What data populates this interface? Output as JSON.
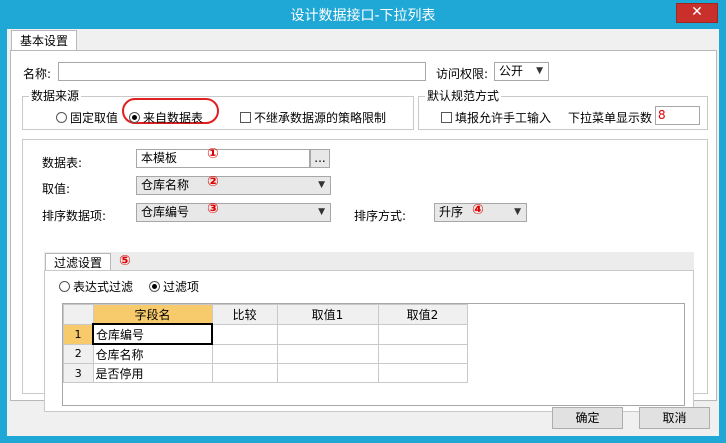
{
  "window": {
    "title": "设计数据接口-下拉列表",
    "close_glyph": "✕"
  },
  "tabs": {
    "basic": "基本设置"
  },
  "basic": {
    "name_label": "名称:",
    "name_value": "",
    "access_label": "访问权限:",
    "access_value": "公开"
  },
  "source_group": {
    "title": "数据来源",
    "fixed_label": "固定取值",
    "from_data_label": "来自数据表",
    "selected": "来自数据表",
    "no_inherit_label": "不继承数据源的策略限制"
  },
  "defaults_group": {
    "title": "默认规范方式",
    "allow_manual_label": "填报允许手工输入",
    "dropdown_count_label": "下拉菜单显示数",
    "dropdown_count_value": "8"
  },
  "source_form": {
    "table_label": "数据表:",
    "table_value": "本模板",
    "browse_label": "...",
    "value_label": "取值:",
    "value_value": "仓库名称",
    "sort_field_label": "排序数据项:",
    "sort_field_value": "仓库编号",
    "sort_mode_label": "排序方式:",
    "sort_mode_value": "升序"
  },
  "markers": [
    "①",
    "②",
    "③",
    "④",
    "⑤"
  ],
  "filter": {
    "tab_label": "过滤设置",
    "expr_label": "表达式过滤",
    "items_label": "过滤项",
    "selected": "过滤项",
    "columns": [
      "字段名",
      "比较",
      "取值1",
      "取值2"
    ],
    "rows": [
      {
        "no": "1",
        "field": "仓库编号",
        "compare": "",
        "v1": "",
        "v2": ""
      },
      {
        "no": "2",
        "field": "仓库名称",
        "compare": "",
        "v1": "",
        "v2": ""
      },
      {
        "no": "3",
        "field": "是否停用",
        "compare": "",
        "v1": "",
        "v2": ""
      }
    ]
  },
  "footer": {
    "ok_label": "确定",
    "cancel_label": "取消"
  },
  "colors": {
    "titlebar": "#1fa7d6",
    "highlight": "#e02020",
    "header_selected": "#f7ca6b"
  }
}
